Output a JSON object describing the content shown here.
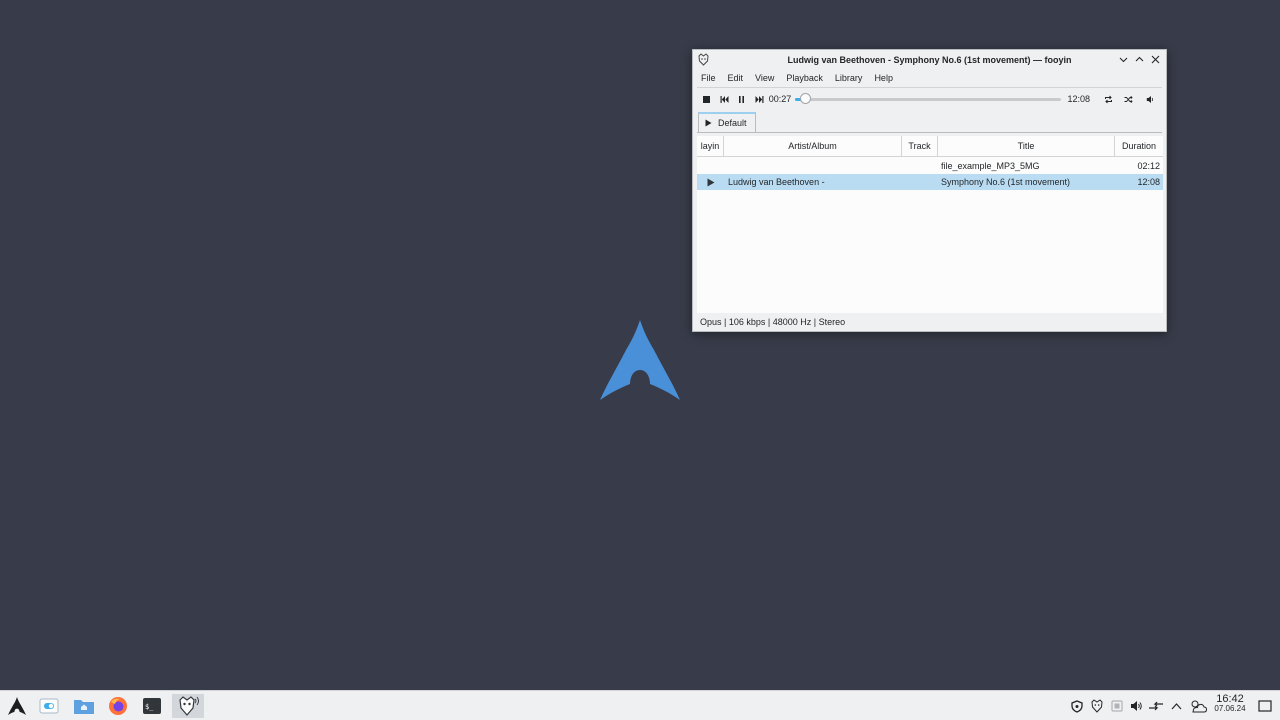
{
  "window": {
    "title": "Ludwig van Beethoven - Symphony No.6 (1st movement) — fooyin"
  },
  "menu": [
    "File",
    "Edit",
    "View",
    "Playback",
    "Library",
    "Help"
  ],
  "controls": {
    "elapsed": "00:27",
    "total": "12:08",
    "progress": 0.037
  },
  "tab": {
    "label": "Default"
  },
  "playlist": {
    "columns": [
      "layin",
      "Artist/Album",
      "Track",
      "Title",
      "Duration"
    ],
    "rows": [
      {
        "artist_album": "",
        "track": "",
        "title": "file_example_MP3_5MG",
        "duration": "02:12",
        "playing": false
      },
      {
        "artist_album": "Ludwig van Beethoven -",
        "track": "",
        "title": "Symphony No.6 (1st movement)",
        "duration": "12:08",
        "playing": true
      }
    ]
  },
  "status": "Opus | 106 kbps | 48000 Hz | Stereo",
  "taskbar": {
    "time": "16:42",
    "date": "07.06.24"
  },
  "colors": {
    "desktop": "#383c4a",
    "accent": "#3daee9",
    "selection": "#b9dcf3",
    "arch_blue": "#4a90d9"
  }
}
